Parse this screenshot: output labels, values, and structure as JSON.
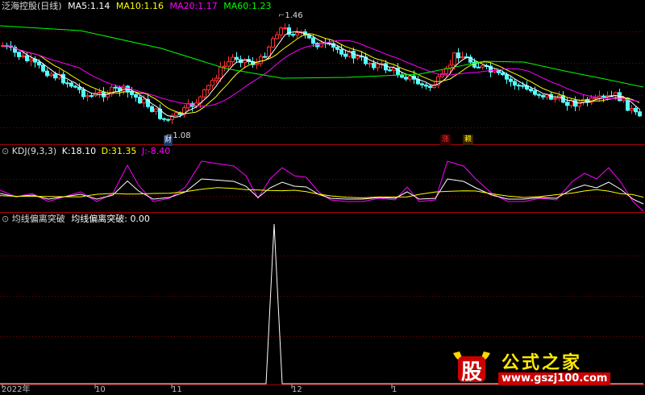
{
  "header": {
    "stock_name": "泛海控股(日线)",
    "ma5_label": "MA5:",
    "ma5_value": "1.14",
    "ma5_color": "#ffffff",
    "ma10_label": "MA10:",
    "ma10_value": "1.16",
    "ma10_color": "#ffff00",
    "ma20_label": "MA20:",
    "ma20_value": "1.17",
    "ma20_color": "#ff00ff",
    "ma60_label": "MA60:",
    "ma60_value": "1.23",
    "ma60_color": "#00ff00"
  },
  "price_panel": {
    "high_marker": "1.46",
    "low_marker": "1.08",
    "signal_1": "涨",
    "signal_2": "赖",
    "low_tag": "财",
    "up_color": "#ff3232",
    "down_color": "#54ffff"
  },
  "kdj_panel": {
    "name": "KDJ(9,3,3)",
    "k_label": "K:",
    "k_value": "18.10",
    "k_color": "#ffffff",
    "d_label": "D:",
    "d_value": "31.35",
    "d_color": "#ffff00",
    "j_label": "J:",
    "j_value": "-8.40",
    "j_color": "#ff00ff"
  },
  "indicator_panel": {
    "name": "均线偏离突破",
    "series_label": "均线偏离突破:",
    "series_value": "0.00"
  },
  "time_axis": {
    "labels": [
      "2022年",
      "10",
      "11",
      "12",
      "1"
    ]
  },
  "watermark": {
    "char": "股",
    "title": "公式之家",
    "url": "www.gszj100.com"
  },
  "colors": {
    "background": "#000000",
    "panel_border": "#c0c0c0",
    "grid_red": "#8a0000",
    "axis_red": "#b00000"
  }
}
